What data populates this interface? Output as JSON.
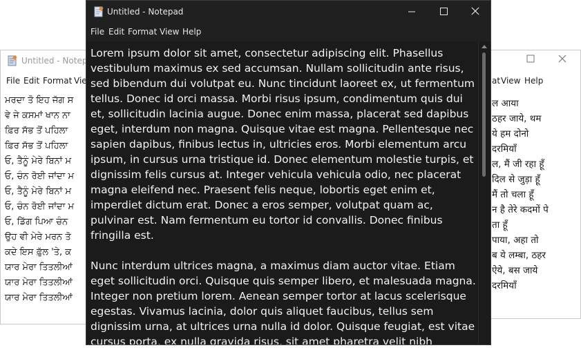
{
  "left_window": {
    "title": "Untitled - Notepad",
    "menu": [
      "File",
      "Edit",
      "Format",
      "View"
    ],
    "lines": [
      "ਮਰਦਾ ਤੋ ਇਹ ਜੱਗ ਸ",
      "ਵੇ ਜੇ ਕਸਮਾਂ ਖਾਨ ਨਾ",
      "ਫ਼ਿਰ ਸੱਭ ਤੋਂ ਪਹਿਲਾ",
      "ਫ਼ਿਰ ਸੱਭ ਤੋਂ ਪਹਿਲਾ",
      "ਓ, ਤੈਨੂੰ ਮੇਰੇ ਬਿਨਾਂ ਮ",
      "ਓ, ਚੰਨ ਰੋਈ ਜਾਂਦਾ ਮ",
      "ਓ, ਤੈਨੂੰ ਮੇਰੇ ਬਿਨਾਂ ਮ",
      "ਓ, ਚੰਨ ਰੋਈ ਜਾਂਦਾ ਮ",
      "ਓ, ਡਿੱਗ ਪਿਆ ਚੰਨ",
      "ਉਹ ਵੀ ਮੇਰੇ ਮਰਨ ਤੋ",
      "ਕਦੇ ਇਸ ਫ਼ੁੱਲ 'ਤੇ, ਕ",
      "ਯਾਰ ਮੇਰਾ ਤਿਤਲੀਆਂ",
      "ਯਾਰ ਮੇਰਾ ਤਿਤਲੀਆਂ",
      "ਯਾਰ ਮੇਰਾ ਤਿਤਲੀਆਂ"
    ]
  },
  "right_window": {
    "menu": [
      "at",
      "View",
      "Help"
    ],
    "lines": [
      "ल आया",
      "ठहर जाये, थम",
      "ये हम दोनो",
      "दरमियाँ",
      "ल, मैं जी रहा हूँ",
      "दिल से जुड़ा हूँ",
      "मैं तो चला हूँ",
      "न है तेरे कदमों पे",
      "ता हूँ",
      "पाया, अहा तो",
      "ब ये लम्बा, ठहर",
      "ऐये, बस जाये",
      "दरमियाँ"
    ]
  },
  "front_window": {
    "title": "Untitled - Notepad",
    "menu": [
      "File",
      "Edit",
      "Format",
      "View",
      "Help"
    ],
    "paragraphs": [
      "Lorem ipsum dolor sit amet, consectetur adipiscing elit. Phasellus vestibulum maximus ex sed accumsan. Nullam sollicitudin ante risus, sed bibendum dui volutpat eu. Nunc tincidunt laoreet ex, ut fermentum tellus. Donec id orci massa. Morbi risus ipsum, condimentum quis dui et, sollicitudin lacinia augue. Donec enim massa, placerat sed dapibus eget, interdum non magna. Quisque vitae est magna. Pellentesque nec sapien dapibus, finibus lectus in, ultricies eros. Morbi elementum arcu ipsum, in cursus urna tristique id. Donec elementum molestie turpis, et dignissim felis cursus at. Integer vehicula vehicula odio, nec placerat magna eleifend nec. Praesent felis neque, lobortis eget enim et, imperdiet dictum erat. Donec a eros semper, volutpat quam ac, pulvinar est. Nam fermentum eu tortor id convallis. Donec finibus fringilla est.",
      "Nunc interdum ultrices magna, a maximus diam auctor vitae. Etiam eget sollicitudin orci. Quisque quis semper libero, et malesuada magna. Integer non pretium lorem. Aenean semper tortor at lacus scelerisque egestas. Vivamus lacinia, dolor quis aliquet faucibus, tellus sem dignissim urna, at ultrices urna nulla id dolor. Quisque feugiat, est vitae cursus porta, ex nulla gravida risus, sit amet pharetra velit nibh"
    ]
  },
  "colors": {
    "dark_bg": "#1b1b1b",
    "dark_titlebar": "#202020",
    "dark_text": "#f2f2f2",
    "light_bg": "#ffffff"
  }
}
